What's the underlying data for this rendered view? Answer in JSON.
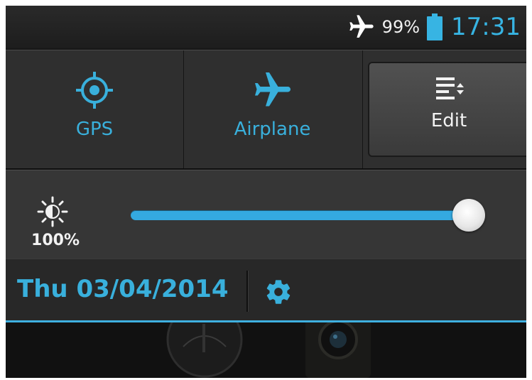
{
  "status_bar": {
    "icons": [
      "airplane-mode-icon",
      "battery-icon"
    ],
    "battery_percent": "99%",
    "time": "17:31",
    "accent_color": "#37b4e3"
  },
  "quick_settings": {
    "tiles": [
      {
        "label": "GPS",
        "icon": "gps-target-icon"
      },
      {
        "label": "Airplane",
        "icon": "airplane-icon"
      },
      {
        "label": "Edit",
        "icon": "edit-list-sort-icon"
      }
    ]
  },
  "brightness": {
    "icon": "brightness-sun-icon",
    "value_label": "100%",
    "level": 1.0
  },
  "date_row": {
    "date": "Thu 03/04/2014",
    "settings_icon": "gear-icon"
  },
  "colors": {
    "accent": "#39b0dc",
    "panel": "#2f2f2f",
    "background": "#171717"
  }
}
